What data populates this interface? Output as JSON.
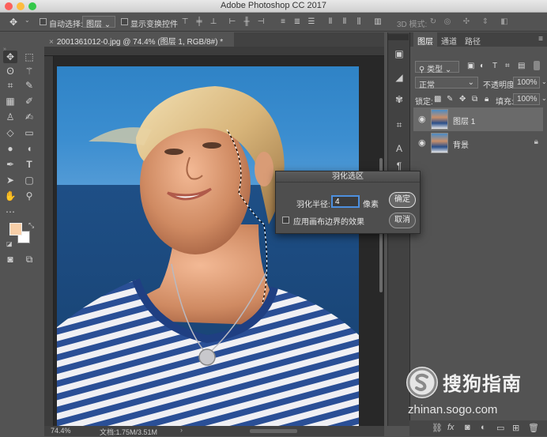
{
  "app": {
    "title": "Adobe Photoshop CC 2017"
  },
  "options_bar": {
    "auto_select_label": "自动选择:",
    "auto_select_value": "图层",
    "show_transform_label": "显示变换控件",
    "mode_3d_label": "3D 模式:"
  },
  "document": {
    "tab_title": "2001361012-0.jpg @ 74.4% (图层 1, RGB/8#) *",
    "zoom": "74.4%",
    "doc_size": "文档:1.75M/3.51M"
  },
  "toolbar": {
    "foreground_color": "#f7cfa8",
    "background_color": "#ffffff",
    "tools": [
      "move-tool",
      "marquee-tool",
      "lasso-tool",
      "magic-wand-tool",
      "crop-tool",
      "eyedropper-tool",
      "healing-brush-tool",
      "brush-tool",
      "clone-stamp-tool",
      "history-brush-tool",
      "eraser-tool",
      "gradient-tool",
      "blur-tool",
      "dodge-tool",
      "pen-tool",
      "type-tool",
      "path-select-tool",
      "shape-tool",
      "hand-tool",
      "zoom-tool",
      "more-tools"
    ]
  },
  "dialog": {
    "title": "羽化选区",
    "radius_label": "羽化半径:",
    "radius_value": "4",
    "unit": "像素",
    "checkbox_label": "应用画布边界的效果",
    "ok_label": "确定",
    "cancel_label": "取消"
  },
  "panel": {
    "tabs": [
      "图层",
      "通道",
      "路径"
    ],
    "kind_filter": "类型",
    "blend_mode": "正常",
    "opacity_label": "不透明度:",
    "opacity_value": "100%",
    "lock_label": "锁定:",
    "fill_label": "填充:",
    "fill_value": "100%",
    "layers": [
      {
        "name": "图层 1",
        "selected": true,
        "locked": false
      },
      {
        "name": "背景",
        "selected": false,
        "locked": true
      }
    ],
    "bottom_icons": [
      "link-icon",
      "fx-icon",
      "mask-icon",
      "adjustment-icon",
      "folder-icon",
      "new-layer-icon",
      "trash-icon"
    ]
  },
  "watermark": {
    "name": "搜狗指南",
    "url": "zhinan.sogo.com"
  }
}
